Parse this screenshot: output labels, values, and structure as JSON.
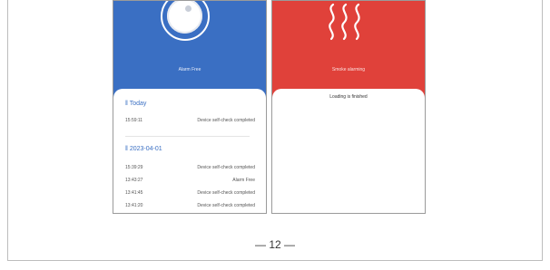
{
  "left_screen": {
    "status_label": "Alarm Free",
    "sections": [
      {
        "heading": "Today",
        "rows": [
          {
            "time": "15:59:11",
            "event": "Device self-check completed"
          }
        ]
      },
      {
        "heading": "2023-04-01",
        "rows": [
          {
            "time": "15:39:29",
            "event": "Device self-check completed"
          },
          {
            "time": "13:43:27",
            "event": "Alarm Free"
          },
          {
            "time": "13:41:45",
            "event": "Device self-check completed"
          },
          {
            "time": "13:41:20",
            "event": "Device self-check completed"
          }
        ]
      }
    ]
  },
  "right_screen": {
    "status_label": "Smoke alarming",
    "message": "Loading is finished"
  },
  "page_number": "— 12 —",
  "colors": {
    "blue": "#3a6fc3",
    "red": "#e0413a"
  },
  "icons": {
    "left_header": "smoke-detector-dial-icon",
    "right_header": "smoke-waves-icon"
  }
}
